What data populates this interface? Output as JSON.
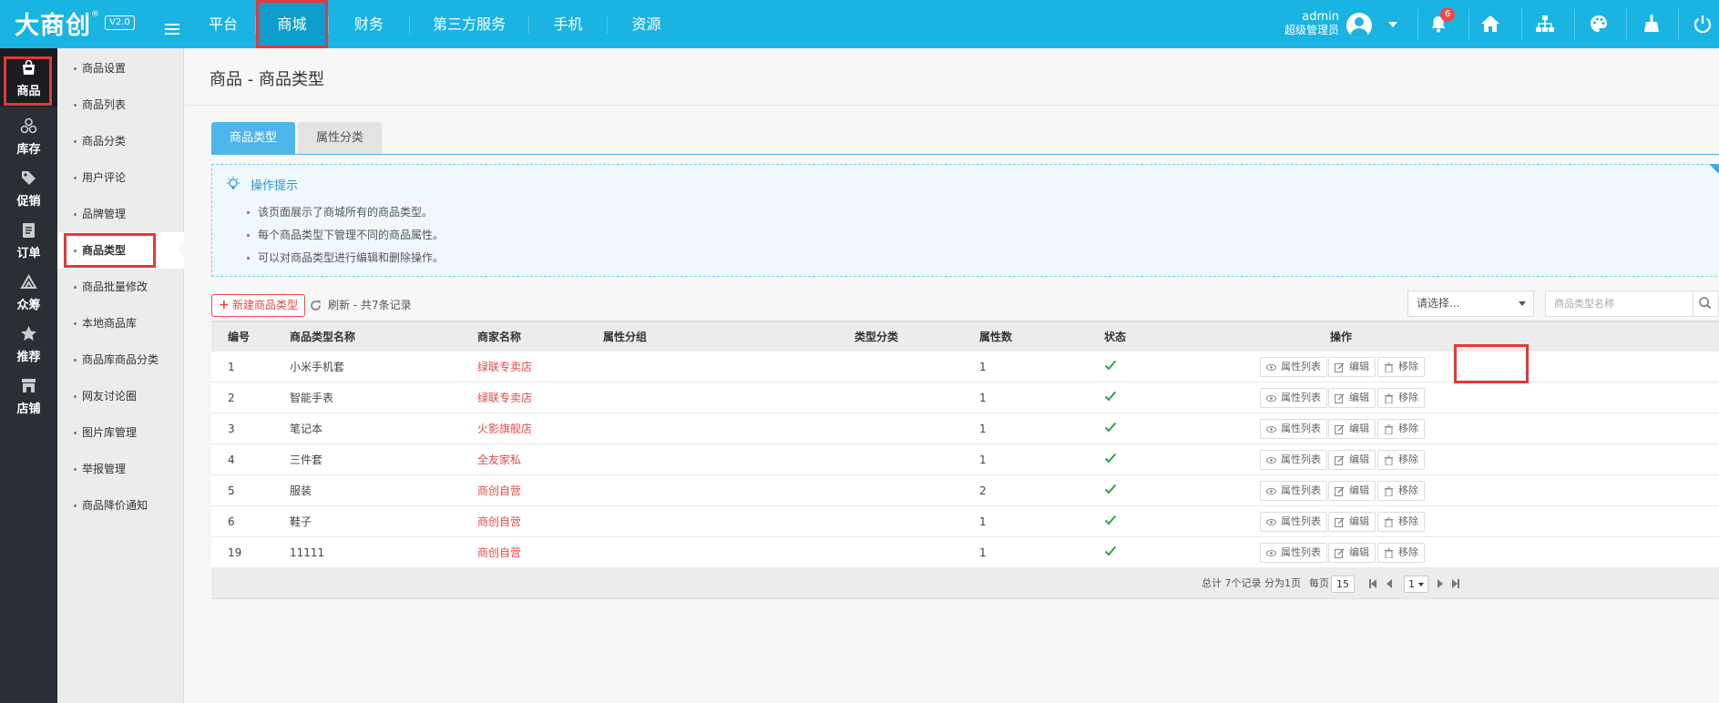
{
  "header": {
    "logo": "大商创",
    "logo_reg": "®",
    "version": "V2.0",
    "nav": [
      {
        "label": "平台"
      },
      {
        "label": "商城"
      },
      {
        "label": "财务"
      },
      {
        "label": "第三方服务"
      },
      {
        "label": "手机"
      },
      {
        "label": "资源"
      }
    ],
    "user_name": "admin",
    "user_role": "超级管理员",
    "notification_count": "6",
    "icons": [
      "bell-icon",
      "home-icon",
      "sitemap-icon",
      "palette-icon",
      "broom-icon",
      "power-icon"
    ]
  },
  "leftbar": [
    {
      "label": "商品",
      "icon": "bag-icon"
    },
    {
      "label": "库存",
      "icon": "boxes-icon"
    },
    {
      "label": "促销",
      "icon": "tag-icon"
    },
    {
      "label": "订单",
      "icon": "order-icon"
    },
    {
      "label": "众筹",
      "icon": "crowdfund-icon"
    },
    {
      "label": "推荐",
      "icon": "star-icon"
    },
    {
      "label": "店铺",
      "icon": "store-icon"
    }
  ],
  "subbar": [
    {
      "label": "商品设置"
    },
    {
      "label": "商品列表"
    },
    {
      "label": "商品分类"
    },
    {
      "label": "用户评论"
    },
    {
      "label": "品牌管理"
    },
    {
      "label": "商品类型"
    },
    {
      "label": "商品批量修改"
    },
    {
      "label": "本地商品库"
    },
    {
      "label": "商品库商品分类"
    },
    {
      "label": "网友讨论圈"
    },
    {
      "label": "图片库管理"
    },
    {
      "label": "举报管理"
    },
    {
      "label": "商品降价通知"
    }
  ],
  "main": {
    "page_title": "商品 - 商品类型",
    "tabs": [
      {
        "label": "商品类型"
      },
      {
        "label": "属性分类"
      }
    ],
    "tips": {
      "title": "操作提示",
      "items": [
        "该页面展示了商城所有的商品类型。",
        "每个商品类型下管理不同的商品属性。",
        "可以对商品类型进行编辑和删除操作。"
      ]
    },
    "toolbar": {
      "add_label": "新建商品类型",
      "refresh_label": "刷新 - 共7条记录",
      "select_placeholder": "请选择...",
      "search_placeholder": "商品类型名称"
    },
    "table": {
      "headers": [
        "编号",
        "商品类型名称",
        "商家名称",
        "属性分组",
        "类型分类",
        "属性数",
        "状态",
        "操作"
      ],
      "rows": [
        {
          "id": "1",
          "name": "小米手机套",
          "shop": "绿联专卖店",
          "group": "",
          "category": "",
          "attr_count": "1"
        },
        {
          "id": "2",
          "name": "智能手表",
          "shop": "绿联专卖店",
          "group": "",
          "category": "",
          "attr_count": "1"
        },
        {
          "id": "3",
          "name": "笔记本",
          "shop": "火影旗舰店",
          "group": "",
          "category": "",
          "attr_count": "1"
        },
        {
          "id": "4",
          "name": "三件套",
          "shop": "全友家私",
          "group": "",
          "category": "",
          "attr_count": "1"
        },
        {
          "id": "5",
          "name": "服装",
          "shop": "商创自营",
          "group": "",
          "category": "",
          "attr_count": "2"
        },
        {
          "id": "6",
          "name": "鞋子",
          "shop": "商创自营",
          "group": "",
          "category": "",
          "attr_count": "1"
        },
        {
          "id": "19",
          "name": "11111",
          "shop": "商创自营",
          "group": "",
          "category": "",
          "attr_count": "1"
        }
      ],
      "actions": {
        "attr_list": "属性列表",
        "edit": "编辑",
        "remove": "移除"
      }
    },
    "footer": {
      "summary": "总计 7个记录 分为1页",
      "per_page_label": "每页",
      "per_page": "15",
      "page": "1"
    }
  },
  "colors": {
    "topbar": "#19b4e2",
    "accent_red": "#e24b4b",
    "tab_active": "#4fb6ec",
    "check": "#2aa34a"
  }
}
